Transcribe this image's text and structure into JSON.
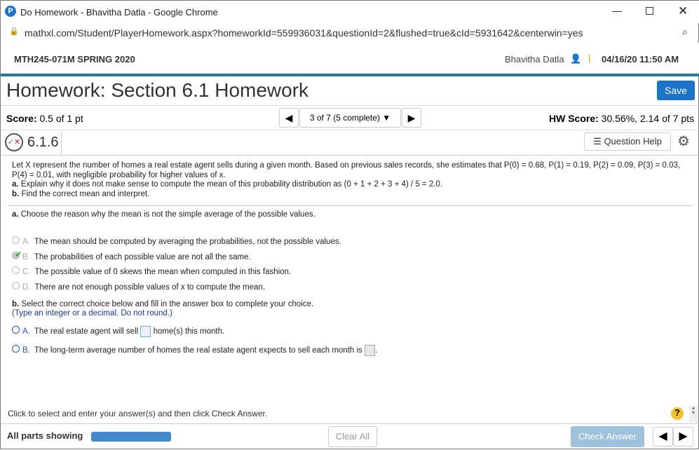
{
  "window": {
    "title": "Do Homework - Bhavitha Datla - Google Chrome",
    "url": "mathxl.com/Student/PlayerHomework.aspx?homeworkId=559936031&questionId=2&flushed=true&cId=5931642&centerwin=yes"
  },
  "course": {
    "name": "MTH245-071M SPRING 2020",
    "user": "Bhavitha Datla",
    "datetime": "04/16/20 11:50 AM"
  },
  "header": {
    "title": "Homework: Section 6.1 Homework",
    "save": "Save"
  },
  "score": {
    "label": "Score:",
    "value": "0.5 of 1 pt",
    "nav": "3 of 7 (5 complete)",
    "hw_label": "HW Score:",
    "hw_value": "30.56%, 2.14 of 7 pts"
  },
  "question": {
    "number": "6.1.6",
    "help": "Question Help",
    "intro": "Let X represent the number of homes a real estate agent sells during a given month. Based on previous sales records, she estimates that P(0) = 0.68, P(1) = 0.19, P(2) = 0.09, P(3) = 0.03, P(4) = 0.01, with negligible probability for higher values of x.",
    "a_label": "a.",
    "a_text": "Explain why it does not make sense to compute the mean of this probability distribution as (0 + 1 + 2 + 3 + 4) / 5 = 2.0.",
    "b_label": "b.",
    "b_text": "Find the correct mean and interpret.",
    "part_a": "Choose the reason why the mean is not the simple average of the possible values.",
    "options_a": [
      {
        "letter": "A.",
        "text": "The mean should be computed by averaging the probabilities, not the possible values."
      },
      {
        "letter": "B.",
        "text": "The probabilities of each possible value are not all the same."
      },
      {
        "letter": "C.",
        "text": "The possible value of 0 skews the mean when computed in this fashion."
      },
      {
        "letter": "D.",
        "text": "There are not enough possible values of x to compute the mean."
      }
    ],
    "selected_a": "B",
    "part_b": "Select the correct choice below and fill in the answer box to complete your choice.",
    "part_b_hint": "(Type an integer or a decimal. Do not round.)",
    "options_b": [
      {
        "letter": "A.",
        "pre": "The real estate agent will sell",
        "post": "home(s) this month."
      },
      {
        "letter": "B.",
        "pre": "The long-term average number of homes the real estate agent expects to sell each month is",
        "post": "."
      }
    ]
  },
  "footer": {
    "instruction": "Click to select and enter your answer(s) and then click Check Answer.",
    "parts": "All parts showing",
    "clear": "Clear All",
    "check": "Check Answer",
    "progress": 1.0
  }
}
